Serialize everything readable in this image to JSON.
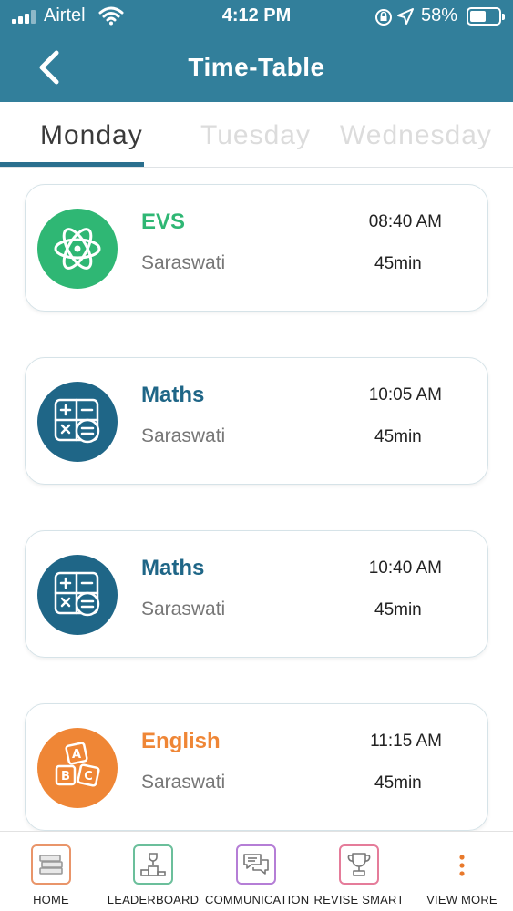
{
  "status_bar": {
    "carrier": "Airtel",
    "time": "4:12 PM",
    "battery_percent": "58%",
    "battery_level": 0.58,
    "icons": [
      "signal-icon",
      "wifi-icon",
      "rotation-lock-icon",
      "location-icon",
      "battery-icon"
    ]
  },
  "header": {
    "title": "Time-Table",
    "back_icon": "chevron-left-icon",
    "background": "#327f9b"
  },
  "tabs": [
    {
      "label": "Monday",
      "active": true
    },
    {
      "label": "Tuesday",
      "active": false
    },
    {
      "label": "Wednesday",
      "active": false
    }
  ],
  "periods": [
    {
      "subject": "EVS",
      "teacher": "Saraswati",
      "time": "08:40 AM",
      "duration": "45min",
      "icon": "atom-icon",
      "color": "#2fb774"
    },
    {
      "subject": "Maths",
      "teacher": "Saraswati",
      "time": "10:05 AM",
      "duration": "45min",
      "icon": "calculator-icon",
      "color": "#1f6687"
    },
    {
      "subject": "Maths",
      "teacher": "Saraswati",
      "time": "10:40 AM",
      "duration": "45min",
      "icon": "calculator-icon",
      "color": "#1f6687"
    },
    {
      "subject": "English",
      "teacher": "Saraswati",
      "time": "11:15 AM",
      "duration": "45min",
      "icon": "abc-blocks-icon",
      "color": "#ef8636"
    }
  ],
  "bottom_nav": [
    {
      "label": "HOME",
      "icon": "books-icon",
      "color": "#e9956a"
    },
    {
      "label": "LEADERBOARD",
      "icon": "podium-icon",
      "color": "#6bbf9b"
    },
    {
      "label": "COMMUNICATION",
      "icon": "chat-bubbles-icon",
      "color": "#b57ed6"
    },
    {
      "label": "REVISE SMART",
      "icon": "trophy-icon",
      "color": "#e57c9a"
    },
    {
      "label": "VIEW MORE",
      "icon": "more-vertical-icon",
      "color": "#e8792b"
    }
  ]
}
